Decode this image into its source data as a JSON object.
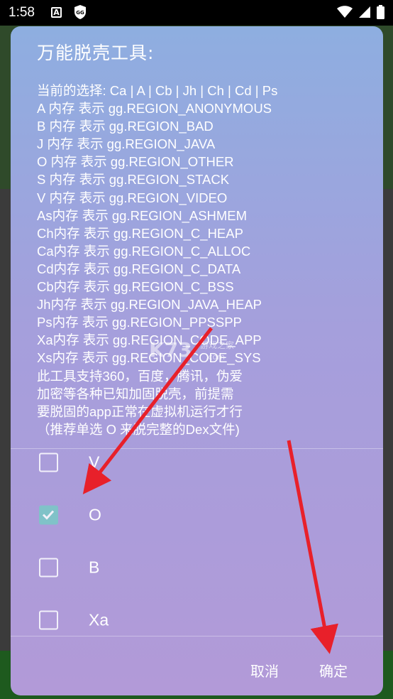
{
  "status_bar": {
    "time": "1:58",
    "notif_a": "A",
    "notif_gg": "GG"
  },
  "dialog": {
    "title": "万能脱壳工具:",
    "message_lines": [
      "当前的选择: Ca | A | Cb | Jh | Ch | Cd | Ps",
      "A 内存 表示 gg.REGION_ANONYMOUS",
      "B 内存 表示 gg.REGION_BAD",
      "J 内存 表示 gg.REGION_JAVA",
      "O 内存 表示 gg.REGION_OTHER",
      "S 内存 表示 gg.REGION_STACK",
      "V 内存 表示 gg.REGION_VIDEO",
      "As内存 表示 gg.REGION_ASHMEM",
      "Ch内存 表示 gg.REGION_C_HEAP",
      "Ca内存 表示 gg.REGION_C_ALLOC",
      "Cd内存 表示 gg.REGION_C_DATA",
      "Cb内存 表示 gg.REGION_C_BSS",
      "Jh内存 表示 gg.REGION_JAVA_HEAP",
      "Ps内存 表示 gg.REGION_PPSSPP",
      "Xa内存 表示 gg.REGION_CODE_APP",
      "Xs内存 表示 gg.REGION_CODE_SYS",
      "此工具支持360，百度，腾讯，伪爱",
      "加密等各种已知加固脱壳，前提需",
      "要脱固的app正常在虚拟机运行才行",
      "（推荐单选 O 来脱完整的Dex文件)"
    ],
    "options": [
      {
        "label": "V",
        "checked": false
      },
      {
        "label": "O",
        "checked": true
      },
      {
        "label": "B",
        "checked": false
      },
      {
        "label": "Xa",
        "checked": false
      }
    ],
    "cancel_label": "取消",
    "ok_label": "确定"
  },
  "watermark": {
    "brand": "K73",
    "sub": "游戏之家",
    "site": ".com"
  },
  "colors": {
    "dialog_top": "#8eaee0",
    "dialog_bottom": "#b29ad8",
    "checkbox_checked": "#79c9c5",
    "annotation_arrow": "#e8202a"
  }
}
